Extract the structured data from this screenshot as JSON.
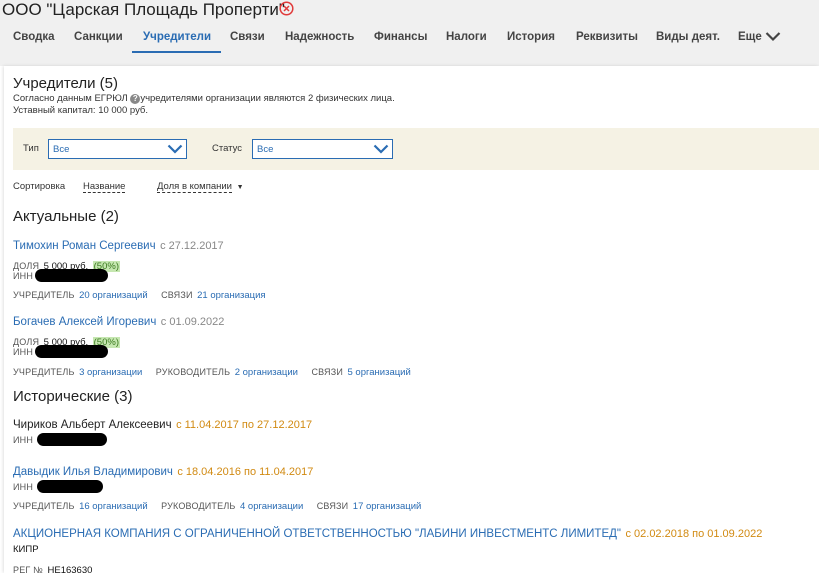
{
  "company": {
    "title": "ООО \"Царская Площадь Проперти\""
  },
  "nav": {
    "tabs": [
      "Сводка",
      "Санкции",
      "Учредители",
      "Связи",
      "Надежность",
      "Финансы",
      "Налоги",
      "История",
      "Реквизиты",
      "Виды деят.",
      "Еще"
    ],
    "active": "Учредители"
  },
  "founders": {
    "heading": "Учредители (5)",
    "egrul_prefix": "Согласно данным ЕГРЮЛ",
    "egrul_suffix": "учредителями организации являются 2 физических лица.",
    "capital": "Уставный капитал: 10 000 руб."
  },
  "filters": {
    "type_label": "Тип",
    "type_value": "Все",
    "status_label": "Статус",
    "status_value": "Все"
  },
  "sort": {
    "label": "Сортировка",
    "by_name": "Название",
    "by_share": "Доля в компании"
  },
  "labels": {
    "share": "ДОЛЯ",
    "inn": "ИНН",
    "founder": "УЧРЕДИТЕЛЬ",
    "links": "СВЯЗИ",
    "manager": "РУКОВОДИТЕЛЬ",
    "reg_no": "РЕГ №"
  },
  "actual": {
    "heading": "Актуальные (2)",
    "items": [
      {
        "name": "Тимохин Роман Сергеевич",
        "date": "с 27.12.2017",
        "share": "5 000 руб.",
        "percent": "(50%)",
        "founder_count": "20 организаций",
        "links_count": "21 организация"
      },
      {
        "name": "Богачев Алексей Игоревич",
        "date": "с 01.09.2022",
        "share": "5 000 руб.",
        "percent": "(50%)",
        "founder_count": "3 организации",
        "manager_count": "2 организации",
        "links_count": "5 организаций"
      }
    ]
  },
  "historical": {
    "heading": "Исторические (3)",
    "items": [
      {
        "name": "Чириков Альберт Алексеевич",
        "period": "с 11.04.2017 по 27.12.2017"
      },
      {
        "name": "Давыдик Илья Владимирович",
        "period": "с 18.04.2016 по 11.04.2017",
        "founder_count": "16 организаций",
        "manager_count": "4 организации",
        "links_count": "17 организаций"
      },
      {
        "name": "АКЦИОНЕРНАЯ КОМПАНИЯ С ОГРАНИЧЕННОЙ ОТВЕТСТВЕННОСТЬЮ \"ЛАБИНИ ИНВЕСТМЕНТС ЛИМИТЕД\"",
        "period": "с 02.02.2018 по 01.09.2022",
        "country": "КИПР",
        "reg_no": "HE163630"
      }
    ]
  },
  "colors": {
    "accent": "#2a6cb3",
    "orange": "#d18a12",
    "close": "#e03a3a",
    "badge": "#c6e7b1"
  },
  "icons": {
    "close": "close-circle-icon",
    "chevron": "chevron-down-icon",
    "help": "help-icon"
  }
}
